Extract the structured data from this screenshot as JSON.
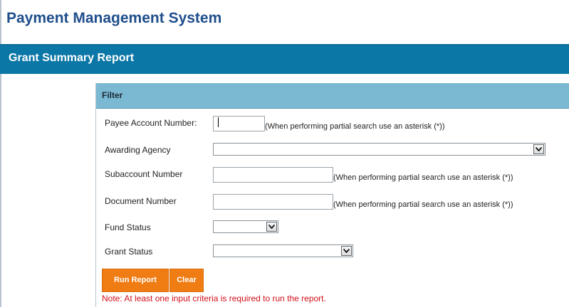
{
  "app": {
    "title": "Payment Management System"
  },
  "report": {
    "title": "Grant Summary Report"
  },
  "filter": {
    "header": "Filter",
    "fields": {
      "payee_account": {
        "label": "Payee Account Number:",
        "value": "",
        "hint": "(When performing partial search use an asterisk (*))"
      },
      "awarding_agency": {
        "label": "Awarding Agency",
        "selected": "",
        "icon": "chevron-down-icon"
      },
      "subaccount": {
        "label": "Subaccount Number",
        "value": "",
        "hint": "(When performing partial search use an asterisk (*))"
      },
      "document": {
        "label": "Document Number",
        "value": "",
        "hint": "(When performing partial search use an asterisk (*))"
      },
      "fund_status": {
        "label": "Fund Status",
        "selected": "",
        "icon": "chevron-down-icon"
      },
      "grant_status": {
        "label": "Grant Status",
        "selected": "",
        "icon": "chevron-down-icon"
      }
    },
    "buttons": {
      "run_report": "Run Report",
      "clear": "Clear"
    },
    "note": "Note: At least one input criteria is required to run the report."
  },
  "colors": {
    "app_title": "#1f4e8c",
    "banner": "#0b77a6",
    "filter_header": "#7bb8d2",
    "button": "#f07c14",
    "note": "#d0101a"
  }
}
